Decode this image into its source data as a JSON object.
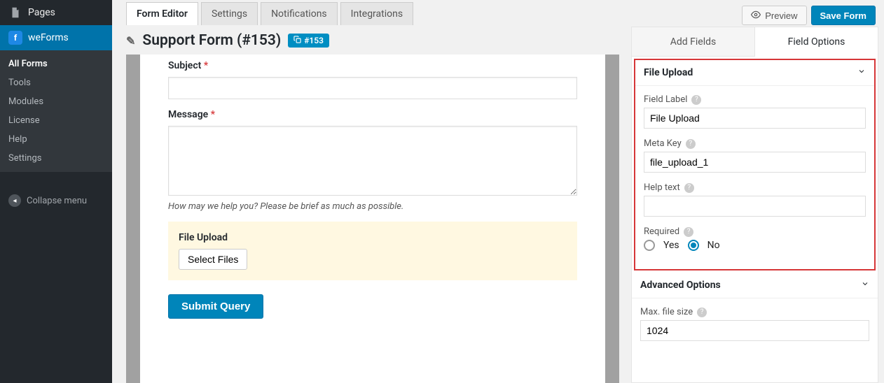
{
  "sidebar": {
    "pages_label": "Pages",
    "weforms_label": "weForms",
    "sub": {
      "all_forms": "All Forms",
      "tools": "Tools",
      "modules": "Modules",
      "license": "License",
      "help": "Help",
      "settings": "Settings"
    },
    "collapse": "Collapse menu"
  },
  "topnav": {
    "tabs": {
      "form_editor": "Form Editor",
      "settings": "Settings",
      "notifications": "Notifications",
      "integrations": "Integrations"
    },
    "preview": "Preview",
    "save": "Save Form"
  },
  "titlebar": {
    "title": "Support Form (#153)",
    "chip": "#153"
  },
  "stage": {
    "subject": {
      "label": "Subject",
      "value": ""
    },
    "message": {
      "label": "Message",
      "value": "",
      "help": "How may we help you? Please be brief as much as possible."
    },
    "file_upload": {
      "label": "File Upload",
      "button": "Select Files"
    },
    "submit": "Submit Query"
  },
  "right_panel": {
    "tabs": {
      "add_fields": "Add Fields",
      "field_options": "Field Options"
    },
    "section_file_upload": "File Upload",
    "field_label": {
      "label": "Field Label",
      "value": "File Upload"
    },
    "meta_key": {
      "label": "Meta Key",
      "value": "file_upload_1"
    },
    "help_text": {
      "label": "Help text",
      "value": ""
    },
    "required": {
      "label": "Required",
      "yes": "Yes",
      "no": "No",
      "selected": "No"
    },
    "advanced": "Advanced Options",
    "max_file_size": {
      "label": "Max. file size",
      "value": "1024"
    }
  }
}
